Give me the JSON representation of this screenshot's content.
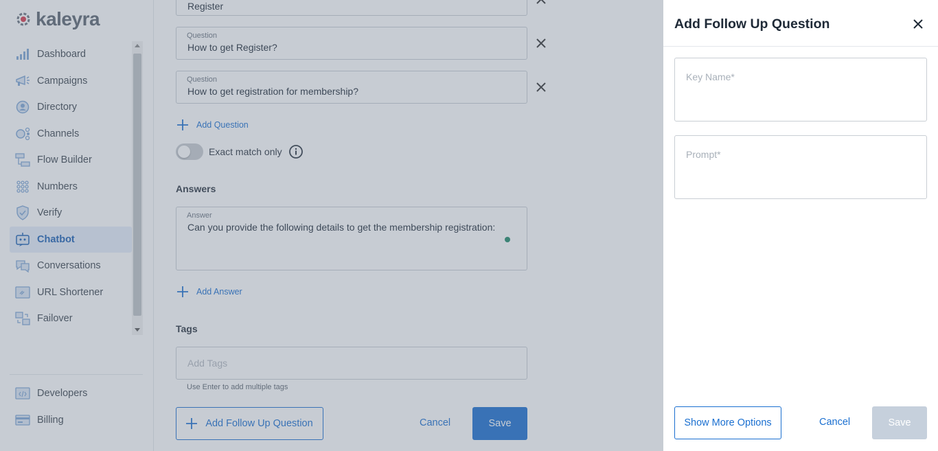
{
  "brand": {
    "name": "kaleyra",
    "accent": "#1a6fd0",
    "logo_red": "#d9394b"
  },
  "sidebar": {
    "items": [
      {
        "label": "Dashboard",
        "icon": "bar-chart-icon"
      },
      {
        "label": "Campaigns",
        "icon": "megaphone-icon"
      },
      {
        "label": "Directory",
        "icon": "contact-icon"
      },
      {
        "label": "Channels",
        "icon": "channels-icon"
      },
      {
        "label": "Flow Builder",
        "icon": "flow-icon"
      },
      {
        "label": "Numbers",
        "icon": "keypad-icon"
      },
      {
        "label": "Verify",
        "icon": "shield-check-icon"
      },
      {
        "label": "Chatbot",
        "icon": "bot-icon",
        "active": true
      },
      {
        "label": "Conversations",
        "icon": "chat-bubbles-icon"
      },
      {
        "label": "URL Shortener",
        "icon": "link-icon"
      },
      {
        "label": "Failover",
        "icon": "failover-icon"
      }
    ],
    "bottom_items": [
      {
        "label": "Developers",
        "icon": "code-icon"
      },
      {
        "label": "Billing",
        "icon": "card-icon"
      }
    ]
  },
  "main": {
    "questions": [
      {
        "label": "",
        "value": "Register"
      },
      {
        "label": "Question",
        "value": "How to get Register?"
      },
      {
        "label": "Question",
        "value": "How to get registration for membership?"
      }
    ],
    "add_question_label": "Add Question",
    "exact_match_label": "Exact match only",
    "exact_match_on": false,
    "answers_title": "Answers",
    "answer": {
      "label": "Answer",
      "value": "Can you provide the following details to get the membership registration:"
    },
    "add_answer_label": "Add Answer",
    "tags_title": "Tags",
    "tags_placeholder": "Add Tags",
    "tags_helper": "Use Enter to add multiple tags",
    "add_follow_up_label": "Add Follow Up Question",
    "cancel_label": "Cancel",
    "save_label": "Save"
  },
  "panel": {
    "title": "Add Follow Up Question",
    "key_name_placeholder": "Key Name*",
    "prompt_placeholder": "Prompt*",
    "show_more_label": "Show More Options",
    "cancel_label": "Cancel",
    "save_label": "Save"
  }
}
